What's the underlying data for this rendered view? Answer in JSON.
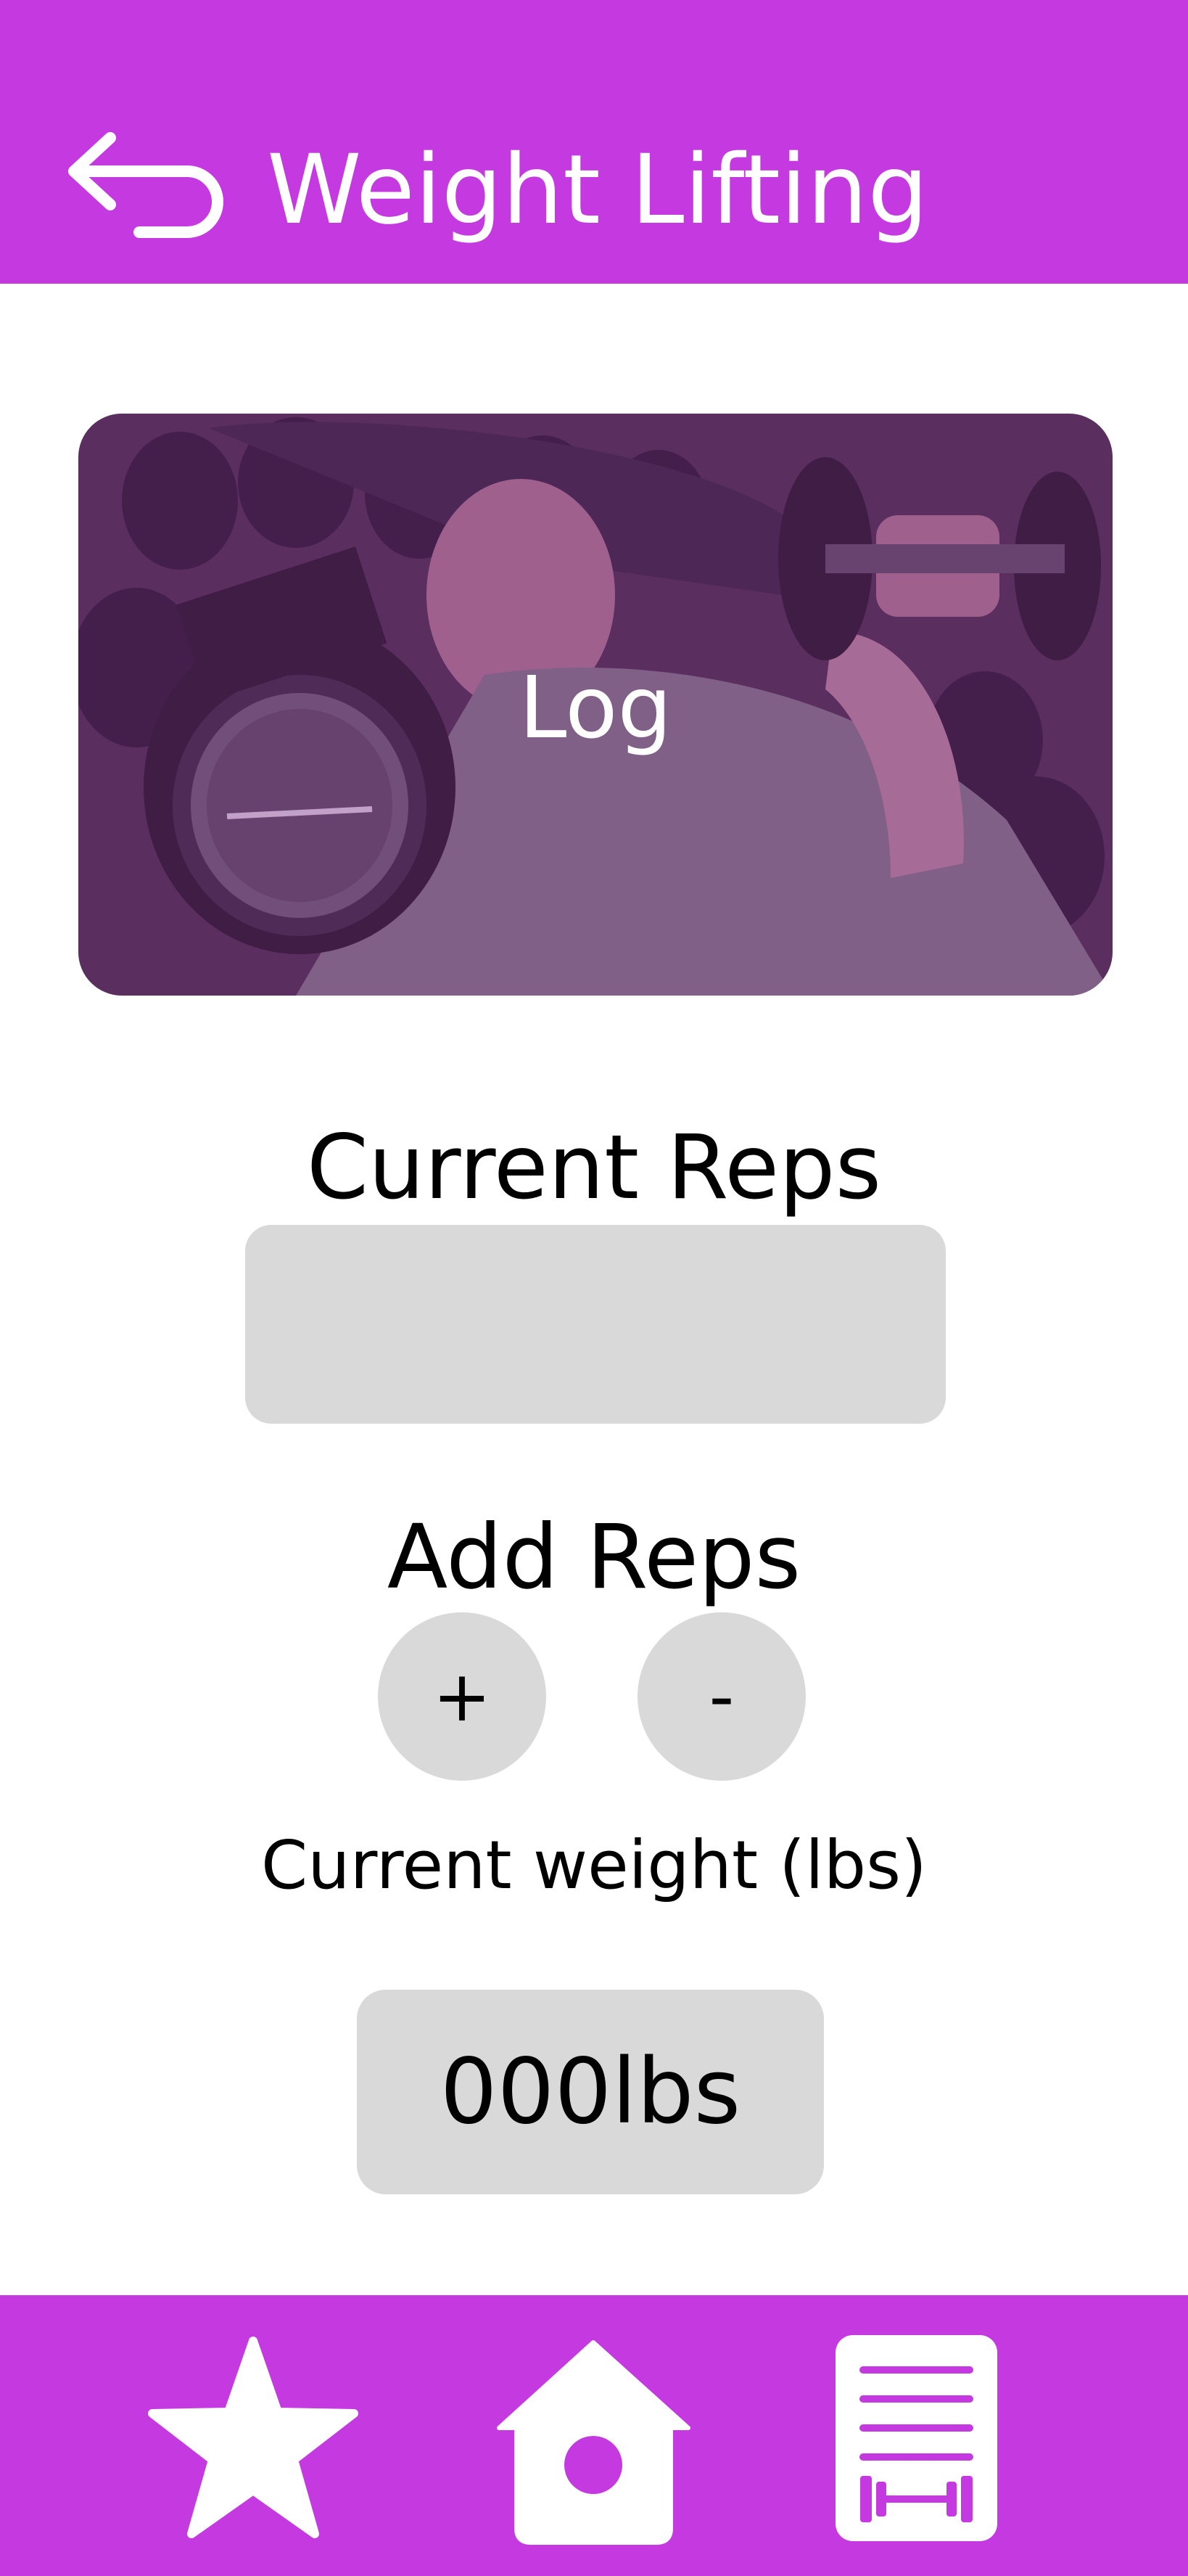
{
  "header": {
    "title": "Weight Lifting",
    "back_icon": "back-arrow-icon"
  },
  "hero": {
    "label": "Log"
  },
  "reps": {
    "label": "Current Reps",
    "value": ""
  },
  "add_reps": {
    "label": "Add Reps",
    "increment_label": "+",
    "decrement_label": "-"
  },
  "weight": {
    "label": "Current weight (lbs)",
    "value": "000lbs"
  },
  "bottom_nav": {
    "items": [
      {
        "icon": "star-icon"
      },
      {
        "icon": "home-icon"
      },
      {
        "icon": "workout-log-icon"
      }
    ]
  },
  "colors": {
    "brand": "#c43ae0",
    "control_fill": "#d9d9d9",
    "text": "#000000",
    "on_brand": "#ffffff"
  }
}
